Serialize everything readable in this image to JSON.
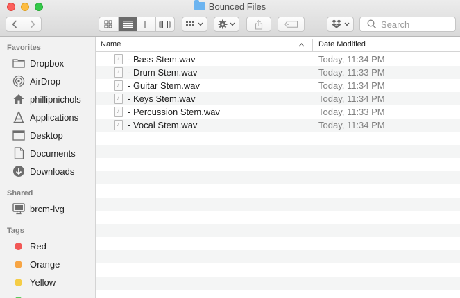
{
  "window": {
    "title": "Bounced Files"
  },
  "toolbar": {
    "back_icon": "chevron-left-icon",
    "forward_icon": "chevron-right-icon",
    "view_modes": [
      "icon-view",
      "list-view",
      "column-view",
      "cover-flow-view"
    ],
    "active_view": "list-view",
    "search_placeholder": "Search"
  },
  "sidebar": {
    "favorites_header": "Favorites",
    "favorites": [
      {
        "label": "Dropbox",
        "icon": "folder-icon"
      },
      {
        "label": "AirDrop",
        "icon": "airdrop-icon"
      },
      {
        "label": "phillipnichols",
        "icon": "home-icon"
      },
      {
        "label": "Applications",
        "icon": "applications-icon"
      },
      {
        "label": "Desktop",
        "icon": "desktop-icon"
      },
      {
        "label": "Documents",
        "icon": "documents-icon"
      },
      {
        "label": "Downloads",
        "icon": "downloads-icon"
      }
    ],
    "shared_header": "Shared",
    "shared": [
      {
        "label": "brcm-lvg",
        "icon": "computer-icon"
      }
    ],
    "tags_header": "Tags",
    "tags": [
      {
        "label": "Red",
        "color": "#f25856"
      },
      {
        "label": "Orange",
        "color": "#f7a544"
      },
      {
        "label": "Yellow",
        "color": "#f5cd46"
      }
    ],
    "partial_tag_color": "#5bc95b"
  },
  "list": {
    "columns": {
      "name": "Name",
      "date_modified": "Date Modified"
    },
    "files": [
      {
        "name": "- Bass Stem.wav",
        "date": "Today, 11:34 PM"
      },
      {
        "name": "- Drum Stem.wav",
        "date": "Today, 11:33 PM"
      },
      {
        "name": "- Guitar Stem.wav",
        "date": "Today, 11:34 PM"
      },
      {
        "name": "- Keys Stem.wav",
        "date": "Today, 11:34 PM"
      },
      {
        "name": "- Percussion Stem.wav",
        "date": "Today, 11:33 PM"
      },
      {
        "name": "- Vocal Stem.wav",
        "date": "Today, 11:34 PM"
      }
    ]
  },
  "colors": {
    "accent_folder": "#6cb4f0",
    "active_segment": "#6b6b6b"
  }
}
